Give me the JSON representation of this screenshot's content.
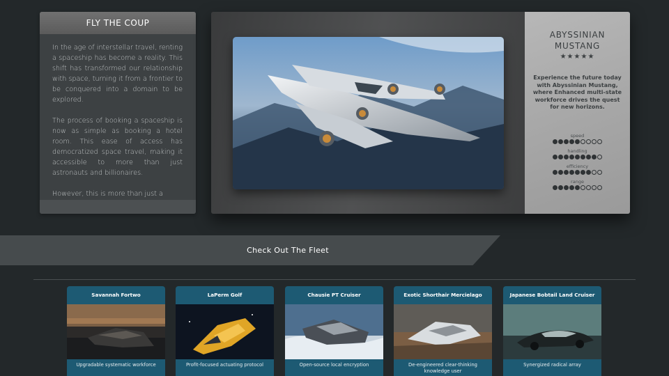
{
  "intro": {
    "title": "FLY THE COUP",
    "paragraphs": [
      "In the age of interstellar travel, renting a spaceship has become a reality. This shift has transformed our relationship with space, turning it from a frontier to be conquered into a domain to be explored.",
      "The process of booking a spaceship is now as simple as booking a hotel room. This ease of access has democratized space travel, making it accessible to more than just astronauts and billionaires.",
      "However, this is more than just a"
    ]
  },
  "featured": {
    "name": "ABYSSINIAN MUSTANG",
    "stars": "★★★★★",
    "tagline": "Experience the future today with Abyssinian Mustang, where Enhanced multi-state workforce drives the quest for new horizons.",
    "stats": [
      {
        "label": "speed",
        "filled": 5,
        "total": 9
      },
      {
        "label": "handling",
        "filled": 8,
        "total": 9
      },
      {
        "label": "efficiency",
        "filled": 7,
        "total": 9
      },
      {
        "label": "range",
        "filled": 5,
        "total": 9
      }
    ]
  },
  "fleet": {
    "heading": "Check Out The Fleet",
    "cards": [
      {
        "title": "Savannah Fortwo",
        "desc": "Upgradable systematic workforce"
      },
      {
        "title": "LaPerm Golf",
        "desc": "Profit-focused actuating protocol"
      },
      {
        "title": "Chausie PT Cruiser",
        "desc": "Open-source local encryption"
      },
      {
        "title": "Exotic Shorthair Mercielago",
        "desc": "De-engineered clear-thinking knowledge user"
      },
      {
        "title": "Japanese Bobtail Land Cruiser",
        "desc": "Synergized radical array"
      }
    ]
  },
  "colors": {
    "background": "#23282a",
    "card_accent": "#1d5a73",
    "panel": "#3d4143",
    "details_panel": "#aaaaaa"
  }
}
